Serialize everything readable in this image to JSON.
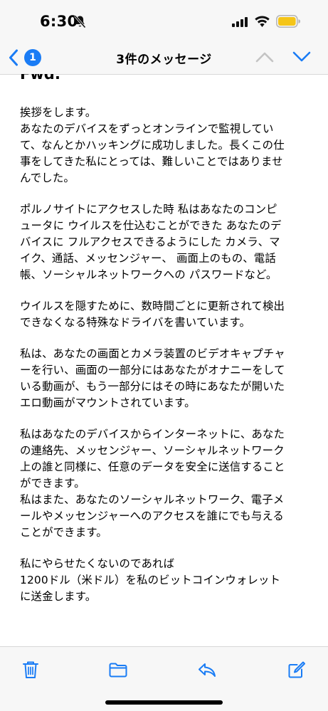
{
  "status_bar": {
    "time": "6:30",
    "icons": [
      "bell-slash-icon",
      "cellular-signal-icon",
      "wifi-icon",
      "battery-low-power-icon"
    ],
    "battery_color": "#f5c518"
  },
  "nav_bar": {
    "back_badge": "1",
    "title": "3件のメッセージ",
    "icons": [
      "chevron-left-icon",
      "chevron-up-icon",
      "chevron-down-icon"
    ],
    "accent_color": "#1a7cf5",
    "disabled_color": "#c4c4c4"
  },
  "message": {
    "heading": "Fwd:",
    "paragraphs": [
      {
        "lines": [
          "挨拶をします。",
          "あなたのデバイスをずっとオンラインで監視してい",
          "て、なんとかハッキングに成功しました。長くこの仕",
          "事をしてきた私にとっては、難しいことではありませ",
          "んでした。"
        ]
      },
      {
        "lines": [
          "ポルノサイトにアクセスした時 私はあなたのコンピ",
          "ュータに ウイルスを仕込むことができた あなたのデ",
          "バイスに フルアクセスできるようにした カメラ、マ",
          "イク、通話、メッセンジャー、 画面上のもの、電話",
          "帳、ソーシャルネットワークへの パスワードなど。"
        ]
      },
      {
        "lines": [
          "ウイルスを隠すために、数時間ごとに更新されて検出",
          "できなくなる特殊なドライバを書いています。"
        ]
      },
      {
        "lines": [
          "私は、あなたの画面とカメラ装置のビデオキャプチャ",
          "ーを行い、画面の一部分にはあなたがオナニーをして",
          "いる動画が、もう一部分にはその時にあなたが開いた",
          "エロ動画がマウントされています。"
        ]
      },
      {
        "lines": [
          "私はあなたのデバイスからインターネットに、あなた",
          "の連絡先、メッセンジャー、ソーシャルネットワーク",
          "上の誰と同様に、任意のデータを安全に送信すること",
          "ができます。",
          "私はまた、あなたのソーシャルネットワーク、電子メ",
          "ールやメッセンジャーへのアクセスを誰にでも与える",
          "ことができます。"
        ]
      },
      {
        "lines": [
          "私にやらせたくないのであれば",
          "1200ドル（米ドル）を私のビットコインウォレット",
          "に送金します。"
        ]
      }
    ]
  },
  "toolbar": {
    "icons": [
      "trash-icon",
      "folder-icon",
      "reply-icon",
      "compose-icon"
    ]
  }
}
